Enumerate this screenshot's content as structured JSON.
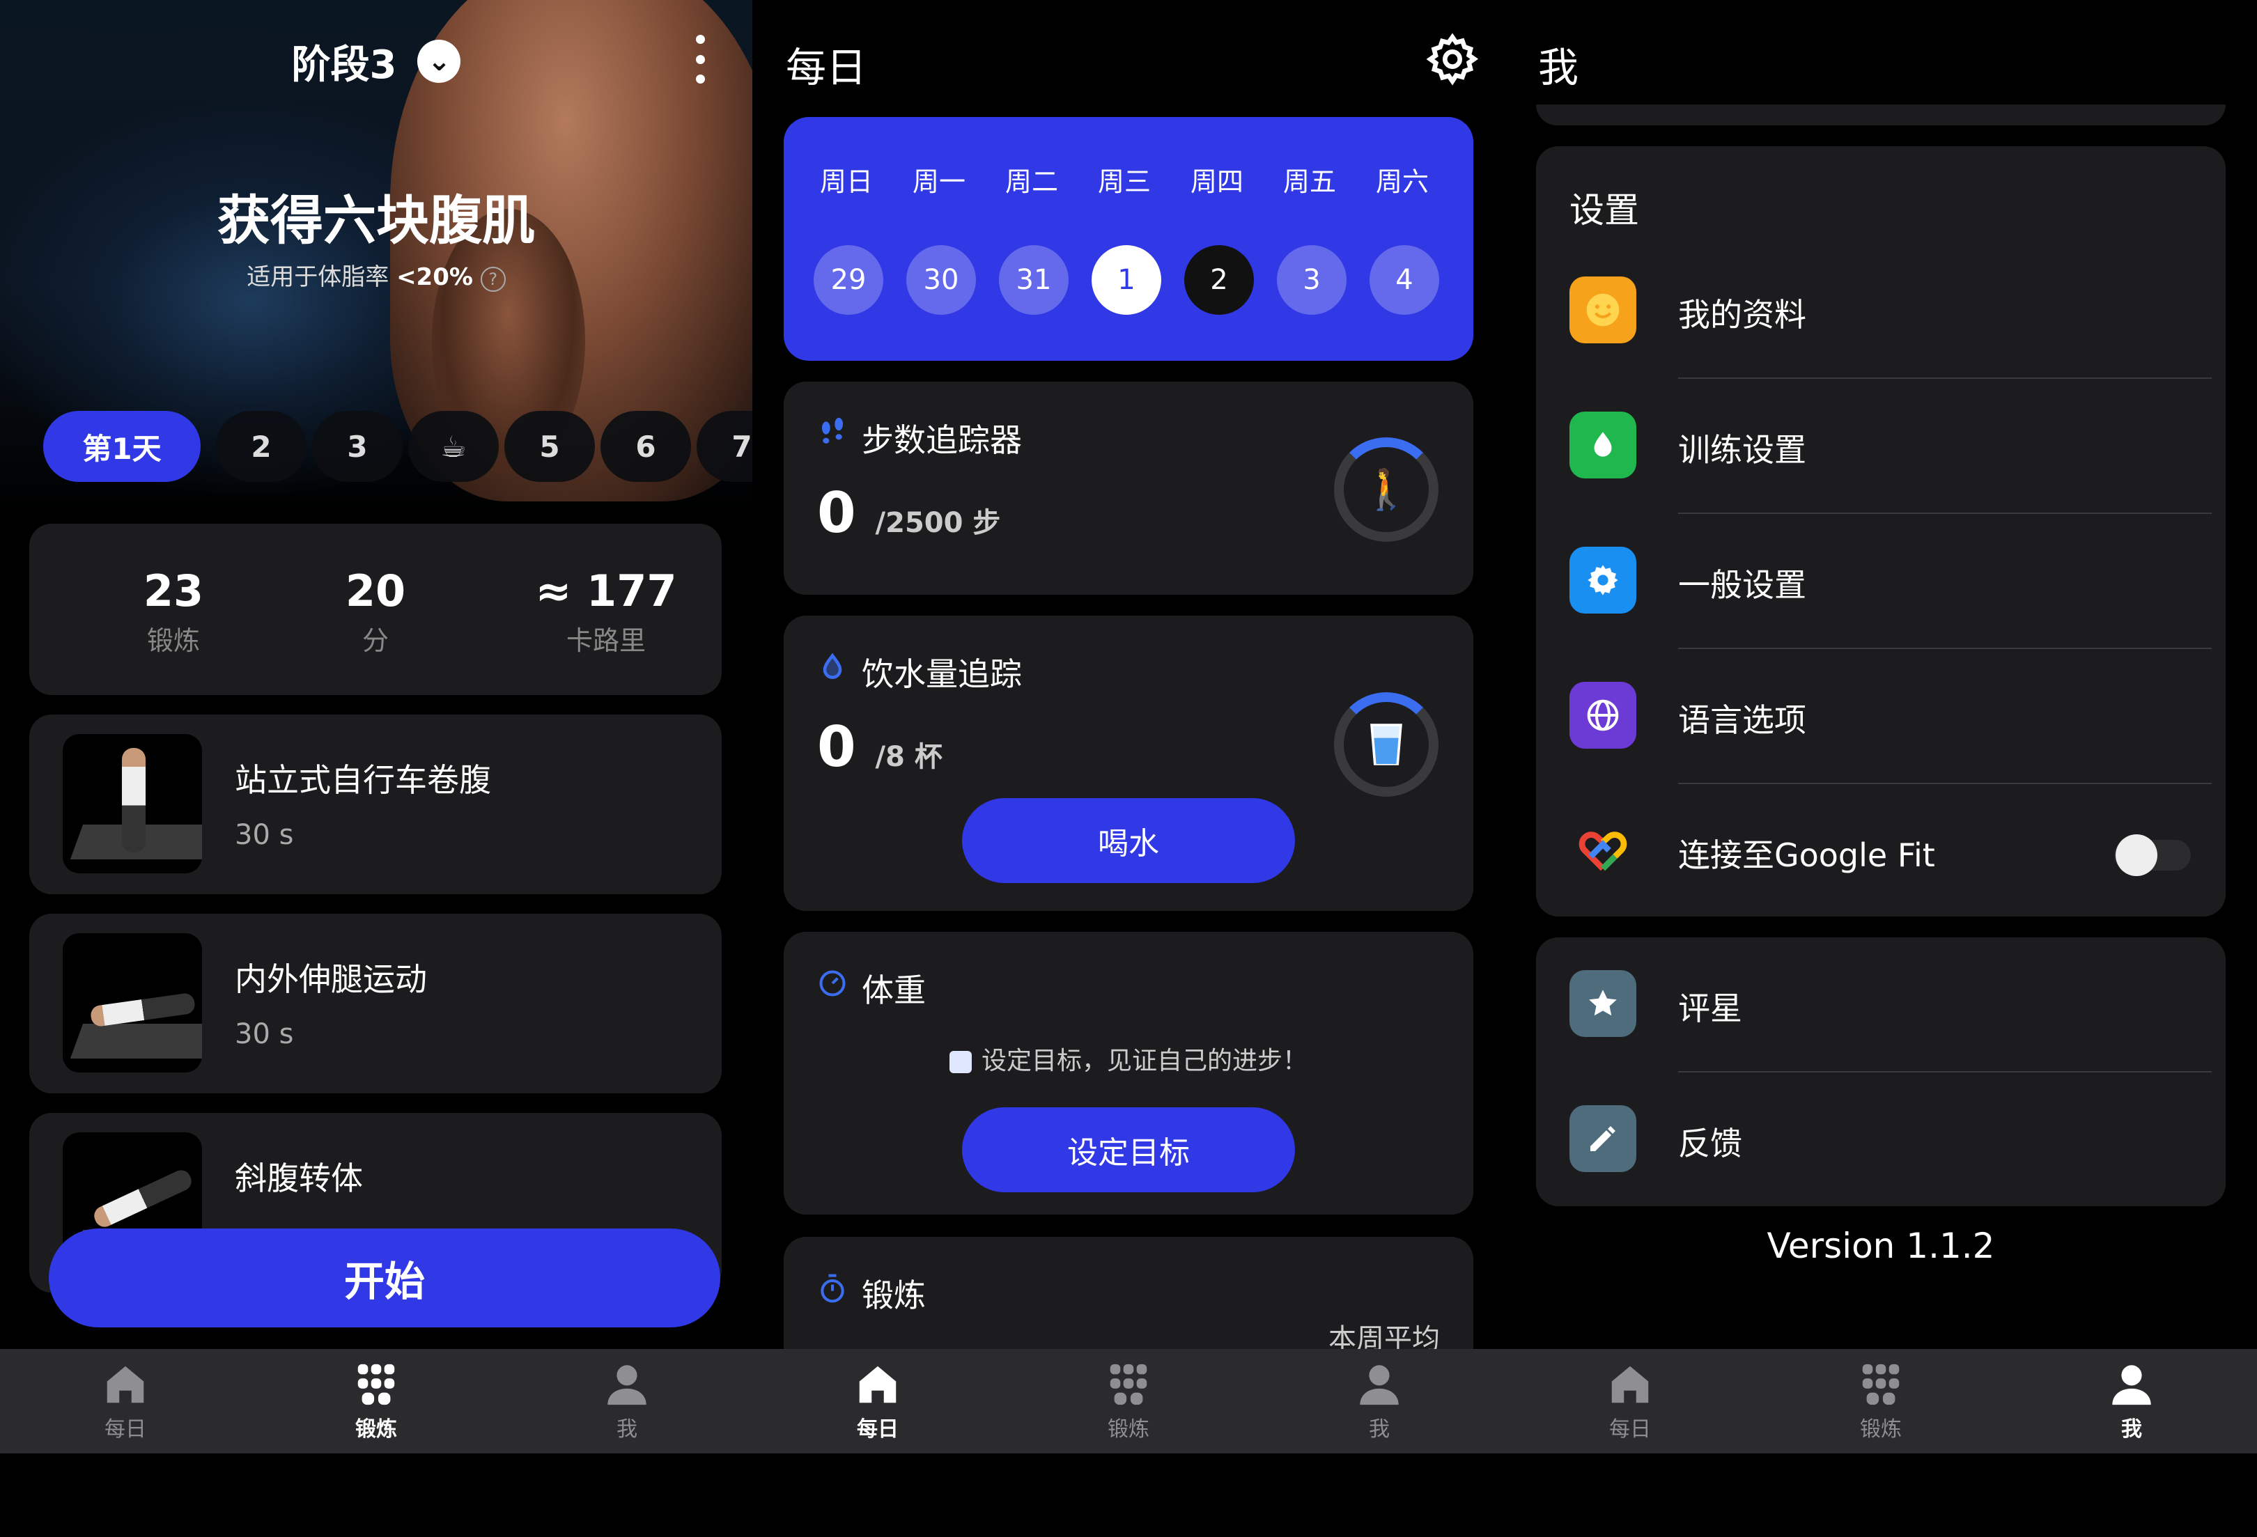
{
  "colors": {
    "accent": "#3039e5",
    "card": "#1c1c1e",
    "nav": "#2b2b2d",
    "profile": "#f6a21a",
    "training": "#1fb74e",
    "general": "#1a8ff2",
    "language": "#6c3bd6",
    "rate": "#4e6c7c",
    "feedback": "#4e6c7c"
  },
  "workout": {
    "stage": "阶段3",
    "title": "获得六块腹肌",
    "subtitle_prefix": "适用于体脂率",
    "subtitle_value": "<20%",
    "subtitle_help": "?",
    "days": [
      "第1天",
      "2",
      "3",
      "☕",
      "5",
      "6",
      "7"
    ],
    "stats": [
      {
        "value": "23",
        "label": "锻炼"
      },
      {
        "value": "20",
        "label": "分"
      },
      {
        "value": "≈ 177",
        "label": "卡路里"
      }
    ],
    "exercises": [
      {
        "name": "站立式自行车卷腹",
        "duration": "30 s"
      },
      {
        "name": "内外伸腿运动",
        "duration": "30 s"
      },
      {
        "name": "斜腹转体",
        "duration": ""
      }
    ],
    "start_label": "开始"
  },
  "daily": {
    "title": "每日",
    "weekdays": [
      "周日",
      "周一",
      "周二",
      "周三",
      "周四",
      "周五",
      "周六"
    ],
    "dates": [
      "29",
      "30",
      "31",
      "1",
      "2",
      "3",
      "4"
    ],
    "steps": {
      "title": "步数追踪器",
      "value": "0",
      "unit": "/2500 步",
      "progress": 0
    },
    "water": {
      "title": "饮水量追踪",
      "value": "0",
      "unit": "/8 杯",
      "button": "喝水",
      "progress": 0
    },
    "weight": {
      "title": "体重",
      "hint": "设定目标，见证自己的进步！",
      "button": "设定目标"
    },
    "workout": {
      "title": "锻炼",
      "avg_label": "本周平均"
    }
  },
  "me": {
    "title": "我",
    "settings_header": "设置",
    "settings": [
      {
        "label": "我的资料",
        "icon": "smile-icon"
      },
      {
        "label": "训练设置",
        "icon": "drop-icon"
      },
      {
        "label": "一般设置",
        "icon": "gear-icon"
      },
      {
        "label": "语言选项",
        "icon": "globe-icon"
      },
      {
        "label": "连接至Google Fit",
        "icon": "google-fit-icon",
        "toggle": false
      }
    ],
    "more": [
      {
        "label": "评星",
        "icon": "star-icon"
      },
      {
        "label": "反馈",
        "icon": "pencil-icon"
      }
    ],
    "version": "Version 1.1.2"
  },
  "nav": {
    "daily": "每日",
    "workout": "锻炼",
    "me": "我"
  }
}
